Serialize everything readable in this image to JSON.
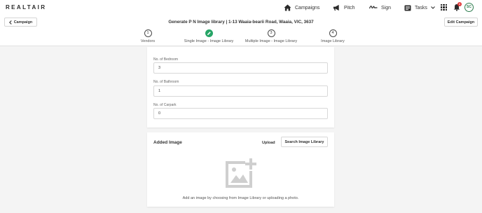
{
  "topbar": {
    "logo": "REALTAIR",
    "nav": [
      {
        "label": "Campaigns",
        "icon": "home-icon"
      },
      {
        "label": "Pitch",
        "icon": "megaphone-icon"
      },
      {
        "label": "Sign",
        "icon": "signature-icon"
      },
      {
        "label": "Tasks",
        "icon": "tasks-icon"
      }
    ],
    "notification_count": "1",
    "avatar_initials": "SC"
  },
  "header": {
    "back_label": "Campaign",
    "title": "Generate P N Image library | 1-13 Waaia-bearii Road, Waaia, VIC, 3637",
    "edit_label": "Edit Campaign"
  },
  "steps": [
    {
      "number": "1",
      "label": "Vendors",
      "status": "pending"
    },
    {
      "number": "",
      "label": "Single Image - Image Library",
      "status": "current"
    },
    {
      "number": "3",
      "label": "Multiple Image - Image Library",
      "status": "pending"
    },
    {
      "number": "4",
      "label": "Image Library",
      "status": "pending"
    }
  ],
  "form": {
    "bedroom": {
      "label": "No. of Bedroom",
      "value": "3"
    },
    "bathroom": {
      "label": "No. of Bathroom",
      "value": "1"
    },
    "carpark": {
      "label": "No. of Carpark",
      "value": "0"
    }
  },
  "added_image": {
    "title": "Added Image",
    "upload_label": "Upload",
    "search_label": "Search Image Library",
    "empty_text": "Add an image by choosing from Image Library or uploading a photo."
  },
  "colors": {
    "accent_green": "#27a567",
    "badge_red": "#e03a3a",
    "avatar_green": "#2e7d4f"
  }
}
